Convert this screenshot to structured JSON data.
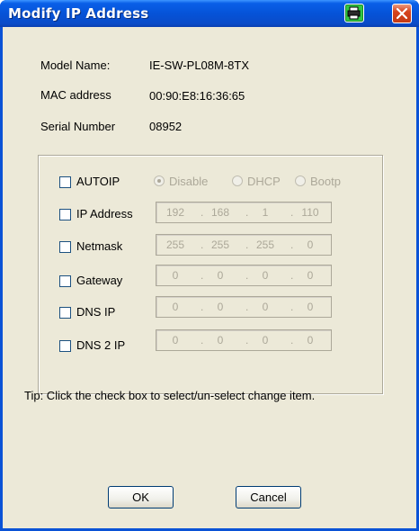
{
  "window": {
    "title": "Modify IP Address",
    "title_icon": "printer-icon",
    "close_icon": "close-icon"
  },
  "info": {
    "model_name_label": "Model Name:",
    "model_name_value": "IE-SW-PL08M-8TX",
    "mac_label": "MAC address",
    "mac_value": "00:90:E8:16:36:65",
    "serial_label": "Serial Number",
    "serial_value": "08952"
  },
  "settings": {
    "autoip": {
      "label": "AUTOIP",
      "checked": false,
      "options": [
        "Disable",
        "DHCP",
        "Bootp"
      ],
      "selected": "Disable"
    },
    "ip_address": {
      "label": "IP Address",
      "checked": false,
      "octets": [
        "192",
        "168",
        "1",
        "110"
      ]
    },
    "netmask": {
      "label": "Netmask",
      "checked": false,
      "octets": [
        "255",
        "255",
        "255",
        "0"
      ]
    },
    "gateway": {
      "label": "Gateway",
      "checked": false,
      "octets": [
        "0",
        "0",
        "0",
        "0"
      ]
    },
    "dns_ip": {
      "label": "DNS IP",
      "checked": false,
      "octets": [
        "0",
        "0",
        "0",
        "0"
      ]
    },
    "dns2_ip": {
      "label": "DNS 2 IP",
      "checked": false,
      "octets": [
        "0",
        "0",
        "0",
        "0"
      ]
    }
  },
  "tip": "Tip: Click the check box to select/un-select change item.",
  "buttons": {
    "ok": "OK",
    "cancel": "Cancel"
  },
  "colors": {
    "titlebar": "#0553d8",
    "dialog_bg": "#ece9d8",
    "disabled_text": "#aca899"
  }
}
